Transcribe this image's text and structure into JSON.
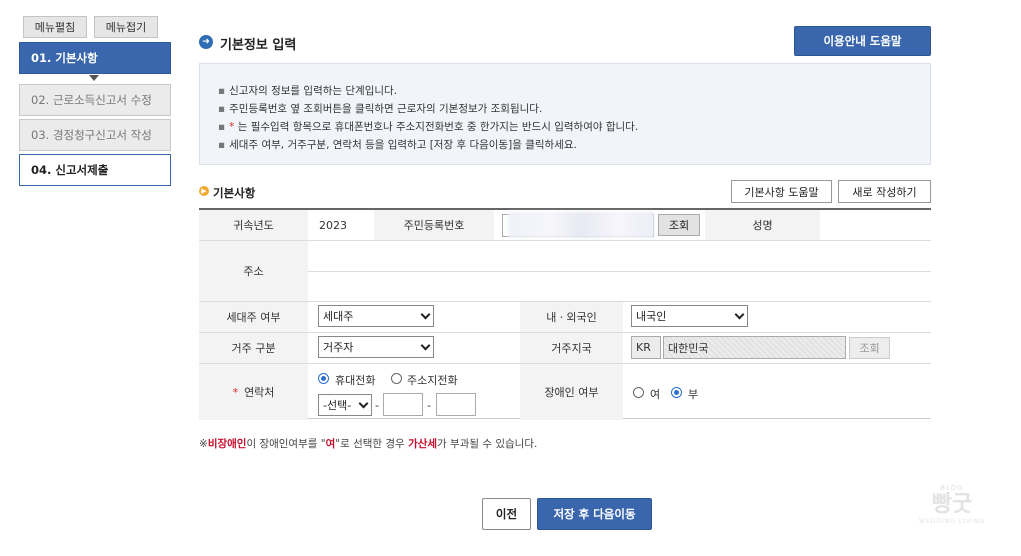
{
  "sidebar": {
    "expand_label": "메뉴펼침",
    "collapse_label": "메뉴접기",
    "steps": [
      {
        "label": "01. 기본사항",
        "state": "active"
      },
      {
        "label": "02. 근로소득신고서 수정",
        "state": "disabled"
      },
      {
        "label": "03. 경정청구신고서 작성",
        "state": "disabled"
      },
      {
        "label": "04. 신고서제출",
        "state": "current"
      }
    ]
  },
  "header": {
    "title": "기본정보 입력",
    "help_button": "이용안내 도움말"
  },
  "info": {
    "lines": [
      "신고자의 정보를 입력하는 단계입니다.",
      "주민등록번호 옆 조회버튼을 클릭하면 근로자의 기본정보가 조회됩니다.",
      "* 는 필수입력 항목으로 휴대폰번호나 주소지전화번호 중 한가지는 반드시 입력하여야 합니다.",
      "세대주 여부, 거주구분, 연락처 등을 입력하고 [저장 후 다음이동]을 클릭하세요."
    ]
  },
  "section": {
    "title": "기본사항",
    "help_button": "기본사항 도움말",
    "new_button": "새로 작성하기"
  },
  "form": {
    "year_label": "귀속년도",
    "year_value": "2023",
    "rrn_label": "주민등록번호",
    "lookup_button": "조회",
    "name_label": "성명",
    "address_label": "주소",
    "household_label": "세대주 여부",
    "household_value": "세대주",
    "nationality_label": "내ㆍ외국인",
    "nationality_value": "내국인",
    "residence_label": "거주 구분",
    "residence_value": "거주자",
    "country_label": "거주지국",
    "country_code": "KR",
    "country_name": "대한민국",
    "country_lookup": "조회",
    "contact_star": "*",
    "contact_label": "연락처",
    "contact_mobile": "휴대전화",
    "contact_home": "주소지전화",
    "contact_select": "-선택-",
    "dash": "-",
    "disability_label": "장애인 여부",
    "disability_yes": "여",
    "disability_no": "부"
  },
  "note": {
    "prefix": "※",
    "red1": "비장애인",
    "mid1": "이 장애인여부를 \"",
    "red2": "여",
    "mid2": "\"로 선택한 경우 ",
    "red3": "가산세",
    "suffix": "가 부과될 수 있습니다."
  },
  "footer": {
    "prev_button": "이전",
    "next_button": "저장 후 다음이동"
  },
  "watermark": {
    "top": "BLOG",
    "main": "빵굿",
    "bottom": "WEDDING LIVING"
  }
}
